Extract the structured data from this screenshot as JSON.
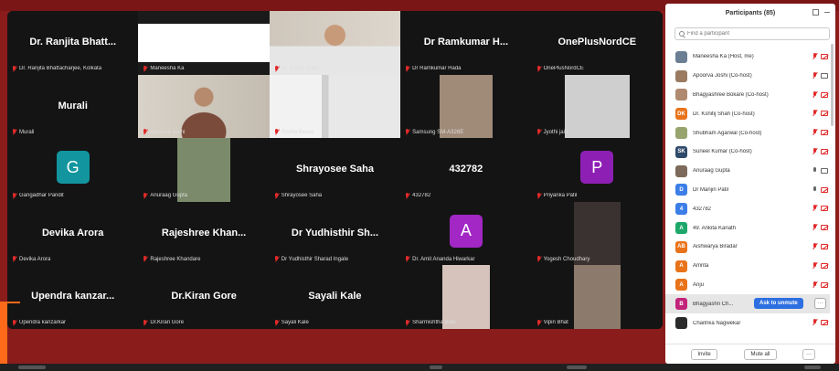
{
  "grid": {
    "tiles": [
      {
        "name": "Dr. Ranjita Bhatt...",
        "label": "Dr. Ranjita Bhattacharjee, Kolkata",
        "kind": "name"
      },
      {
        "name": "",
        "label": "Maneesha Ka",
        "kind": "slide"
      },
      {
        "name": "",
        "label": "Dr. Kshitij Shah",
        "kind": "video-man"
      },
      {
        "name": "Dr Ramkumar H...",
        "label": "Dr Ramkumar Hada",
        "kind": "name"
      },
      {
        "name": "OnePlusNordCE",
        "label": "OnePlusNordCE",
        "kind": "name"
      },
      {
        "name": "Murali",
        "label": "Murali",
        "kind": "name"
      },
      {
        "name": "",
        "label": "Apoorva Joshi",
        "kind": "video-woman"
      },
      {
        "name": "",
        "label": "Sneha Bewar",
        "kind": "video-wall"
      },
      {
        "name": "",
        "label": "Samsung SM-A326E",
        "kind": "video-room"
      },
      {
        "name": "",
        "label": "Jyothi jain",
        "kind": "video-blur"
      },
      {
        "name": "",
        "label": "Gangadhar Pandit",
        "kind": "avatar",
        "letter": "G",
        "color": "#12959e"
      },
      {
        "name": "",
        "label": "Anuraag Gupta",
        "kind": "video-plant"
      },
      {
        "name": "Shrayosee Saha",
        "label": "Shrayosee Saha",
        "kind": "name"
      },
      {
        "name": "432782",
        "label": "432782",
        "kind": "name"
      },
      {
        "name": "",
        "label": "Priyanka Patil",
        "kind": "avatar",
        "letter": "P",
        "color": "#8e1fb5"
      },
      {
        "name": "Devika Arora",
        "label": "Devika Arora",
        "kind": "name"
      },
      {
        "name": "Rajeshree Khan...",
        "label": "Rajeshree Khandare",
        "kind": "name"
      },
      {
        "name": "Dr Yudhisthir Sh...",
        "label": "Dr Yudhisthir Sharad Ingale",
        "kind": "name"
      },
      {
        "name": "",
        "label": "Dr. Amit Ananda Hiwarkar",
        "kind": "avatar",
        "letter": "A",
        "color": "#a227c4"
      },
      {
        "name": "",
        "label": "Yogesh Choudhary",
        "kind": "video-dark"
      },
      {
        "name": "Upendra kanzar...",
        "label": "Upendra kanzarkar",
        "kind": "name"
      },
      {
        "name": "Dr.Kiran Gore",
        "label": "Dr.Kiran Gore",
        "kind": "name"
      },
      {
        "name": "Sayali Kale",
        "label": "Sayali Kale",
        "kind": "name"
      },
      {
        "name": "",
        "label": "Sharmishtha Bele",
        "kind": "video-girl"
      },
      {
        "name": "",
        "label": "Vipin Bhat",
        "kind": "video-room2"
      }
    ]
  },
  "participants": {
    "title": "Participants (85)",
    "search_placeholder": "Find a participant",
    "list": [
      {
        "name": "Maneesha Ka (Host, me)",
        "av": "",
        "color": "#6b7e93",
        "photo": true,
        "mic": "off",
        "cam": "off"
      },
      {
        "name": "Apoorva Joshi (Co-host)",
        "av": "",
        "color": "#9a7b62",
        "photo": true,
        "mic": "off",
        "cam": "on"
      },
      {
        "name": "Bhagyashree Bokare (Co-host)",
        "av": "",
        "color": "#b08a70",
        "photo": true,
        "mic": "off",
        "cam": "off"
      },
      {
        "name": "Dr. Kshitij Shah (Co-host)",
        "av": "DK",
        "color": "#e8731a",
        "photo": false,
        "mic": "off",
        "cam": "off"
      },
      {
        "name": "Shubham Agarwal (Co-host)",
        "av": "",
        "color": "#98a46d",
        "photo": true,
        "mic": "off",
        "cam": "off"
      },
      {
        "name": "Suneel Kumar (Co-host)",
        "av": "SK",
        "color": "#2f4a6a",
        "photo": false,
        "mic": "off",
        "cam": "off"
      },
      {
        "name": "Anuraag Gupta",
        "av": "",
        "color": "#7d6a5a",
        "photo": true,
        "mic": "on",
        "cam": "on"
      },
      {
        "name": "Dr Manjiri Patil",
        "av": "D",
        "color": "#3c7ee8",
        "photo": false,
        "mic": "on",
        "cam": "off"
      },
      {
        "name": "432782",
        "av": "4",
        "color": "#3c7ee8",
        "photo": false,
        "mic": "off",
        "cam": "off"
      },
      {
        "name": "49. Ankita Kanath",
        "av": "A",
        "color": "#1ea76a",
        "photo": false,
        "mic": "off",
        "cam": "off"
      },
      {
        "name": "Aishwarya Biradar",
        "av": "AB",
        "color": "#e8731a",
        "photo": false,
        "mic": "off",
        "cam": "off"
      },
      {
        "name": "Amrita",
        "av": "A",
        "color": "#e8731a",
        "photo": false,
        "mic": "off",
        "cam": "off"
      },
      {
        "name": "Anju",
        "av": "A",
        "color": "#e8731a",
        "photo": false,
        "mic": "off",
        "cam": "off"
      },
      {
        "name": "Bhagyashri Ch...",
        "av": "B",
        "color": "#c2247a",
        "photo": false,
        "mic": "",
        "cam": "",
        "highlight": true
      },
      {
        "name": "Chaitrika Nagwekar",
        "av": "",
        "color": "#2a2a2a",
        "photo": true,
        "mic": "off",
        "cam": "off"
      }
    ],
    "ask_unmute_label": "Ask to unmute",
    "more_label": "···",
    "invite_label": "Invite",
    "mute_all_label": "Mute all",
    "footer_more_label": "···"
  }
}
